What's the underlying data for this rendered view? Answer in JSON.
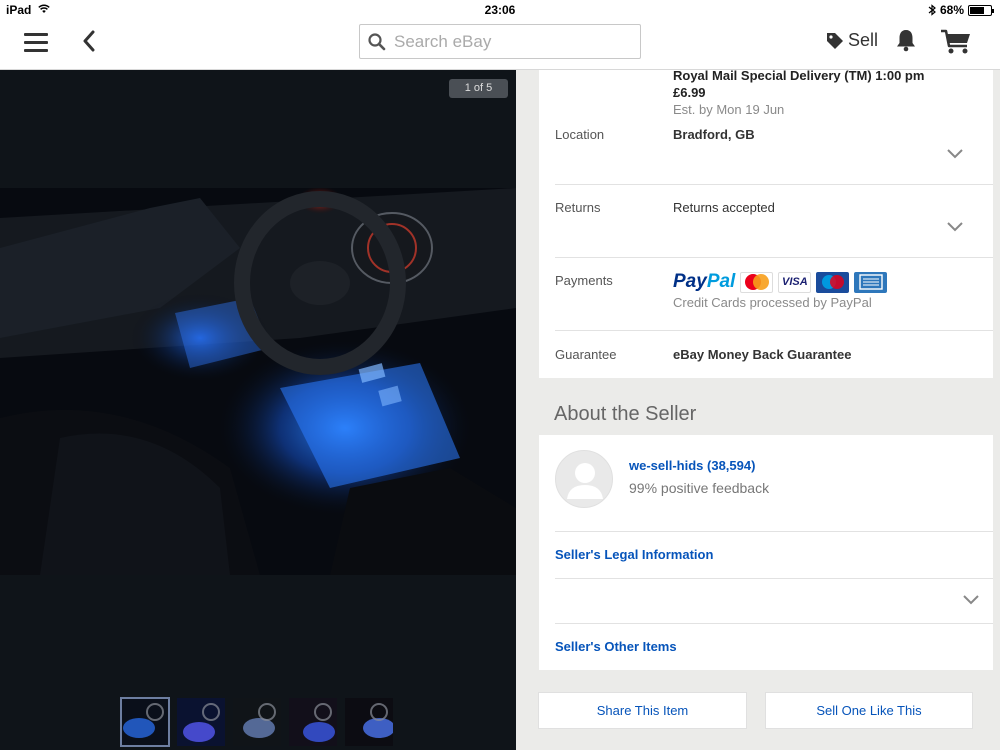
{
  "status_bar": {
    "device": "iPad",
    "time": "23:06",
    "battery": "68%",
    "battery_level": 0.68
  },
  "nav": {
    "search_placeholder": "Search eBay",
    "sell_label": "Sell",
    "icons": [
      "menu-icon",
      "back-icon",
      "search-icon",
      "tag-icon",
      "bell-icon",
      "cart-icon"
    ]
  },
  "gallery": {
    "counter": "1 of 5",
    "thumbnail_count": 5,
    "selected_index": 0
  },
  "shipping": {
    "service": "Royal Mail Special Delivery (TM) 1:00 pm",
    "price": "£6.99",
    "estimate": "Est. by Mon 19 Jun"
  },
  "details": {
    "location_label": "Location",
    "location_value": "Bradford, GB",
    "returns_label": "Returns",
    "returns_value": "Returns accepted",
    "payments_label": "Payments",
    "payments_logos": [
      "PayPal",
      "MasterCard",
      "VISA",
      "Maestro",
      "American Express"
    ],
    "payments_note": "Credit Cards processed by PayPal",
    "guarantee_label": "Guarantee",
    "guarantee_value": "eBay Money Back Guarantee"
  },
  "seller": {
    "section_title": "About the Seller",
    "name": "we-sell-hids (38,594)",
    "feedback": "99% positive feedback",
    "legal_info": "Seller's Legal Information",
    "other_items": "Seller's Other Items"
  },
  "actions": {
    "share": "Share This Item",
    "sell_one": "Sell One Like This"
  },
  "colors": {
    "link": "#0654ba",
    "background": "#ebebe9",
    "gallery_bg": "#0f1419",
    "paypal_dark": "#003087",
    "paypal_light": "#009cde"
  }
}
